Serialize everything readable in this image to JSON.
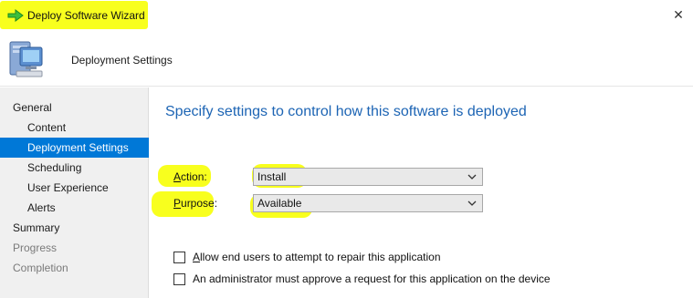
{
  "window": {
    "title": "Deploy Software Wizard",
    "close_glyph": "✕",
    "title_icon": "green-arrow-icon"
  },
  "header": {
    "title": "Deployment Settings",
    "icon": "computer-icon"
  },
  "nav": {
    "items": [
      {
        "label": "General",
        "level": 1,
        "state": "normal"
      },
      {
        "label": "Content",
        "level": 2,
        "state": "normal"
      },
      {
        "label": "Deployment Settings",
        "level": 2,
        "state": "selected"
      },
      {
        "label": "Scheduling",
        "level": 2,
        "state": "normal"
      },
      {
        "label": "User Experience",
        "level": 2,
        "state": "normal"
      },
      {
        "label": "Alerts",
        "level": 2,
        "state": "normal"
      },
      {
        "label": "Summary",
        "level": 1,
        "state": "normal"
      },
      {
        "label": "Progress",
        "level": 1,
        "state": "disabled"
      },
      {
        "label": "Completion",
        "level": 1,
        "state": "disabled"
      }
    ]
  },
  "main": {
    "heading": "Specify settings to control how this software is deployed",
    "action": {
      "label_prefix": "A",
      "label_rest": "ction:",
      "value": "Install"
    },
    "purpose": {
      "label_prefix": "P",
      "label_rest": "urpose:",
      "value": "Available"
    },
    "checkboxes": [
      {
        "label_prefix": "A",
        "label_rest": "llow end users to attempt to repair this application",
        "checked": false
      },
      {
        "label_prefix": "",
        "label_rest": "An administrator must approve a request for this application on the device",
        "checked": false
      }
    ]
  },
  "colors": {
    "highlight": "#f8ff1e",
    "selection": "#0078d7",
    "heading": "#1c64b4",
    "nav_bg": "#f0f0f0"
  }
}
